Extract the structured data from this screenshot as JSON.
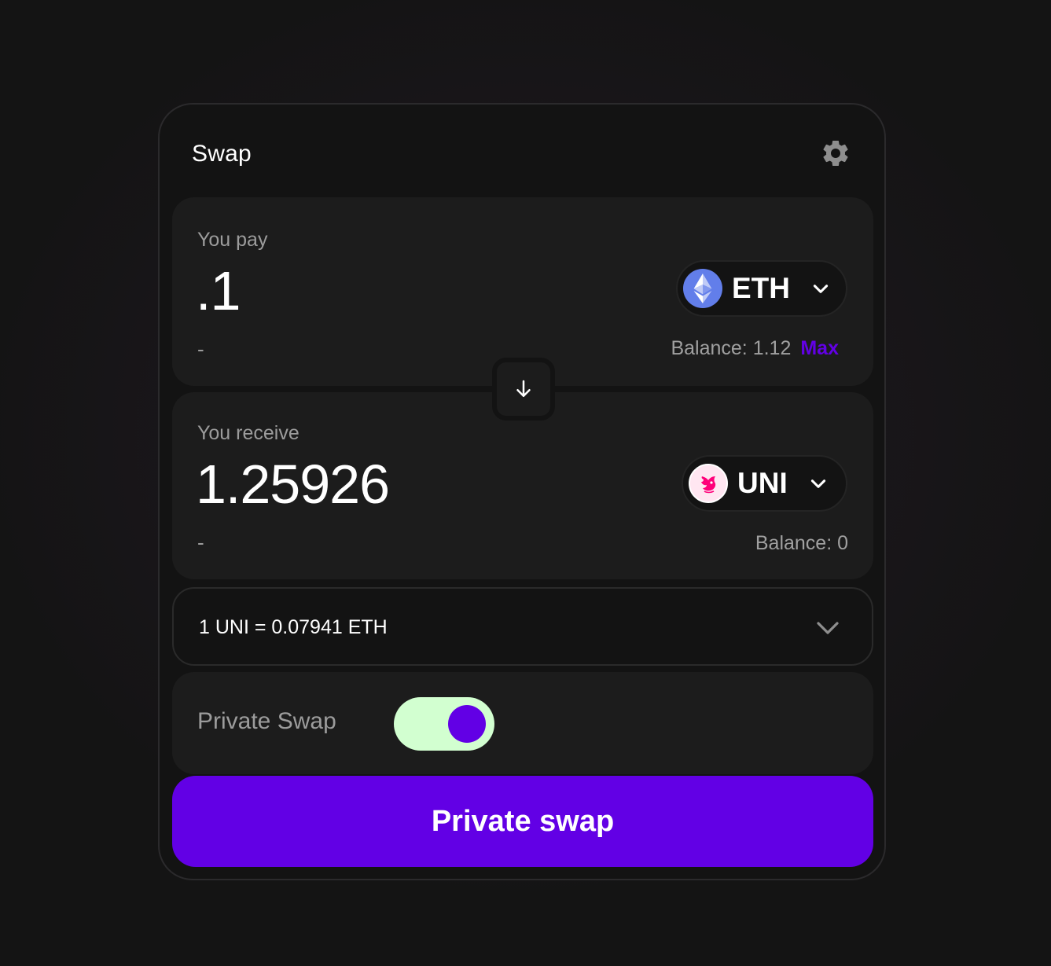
{
  "header": {
    "title": "Swap",
    "settings_icon": "gear-icon"
  },
  "pay": {
    "label": "You pay",
    "amount": ".1",
    "usd_value": "-",
    "token": {
      "symbol": "ETH",
      "icon": "eth-icon",
      "icon_bg": "#627eea"
    },
    "balance_label": "Balance: 1.12",
    "max_label": "Max"
  },
  "swap_direction_icon": "arrow-down-icon",
  "receive": {
    "label": "You receive",
    "amount": "1.25926",
    "usd_value": "-",
    "token": {
      "symbol": "UNI",
      "icon": "uni-icon",
      "icon_bg": "#ffe6f1"
    },
    "balance_label": "Balance: 0"
  },
  "rate": {
    "text": "1 UNI = 0.07941 ETH",
    "expand_icon": "chevron-down-icon"
  },
  "private_swap": {
    "label": "Private Swap",
    "enabled": true
  },
  "action": {
    "label": "Private swap"
  },
  "colors": {
    "accent": "#6200e5",
    "toggle_on": "#d2ffd0",
    "card_bg": "#131313",
    "panel_bg": "#1c1c1c",
    "muted_text": "#9c9c9c"
  }
}
